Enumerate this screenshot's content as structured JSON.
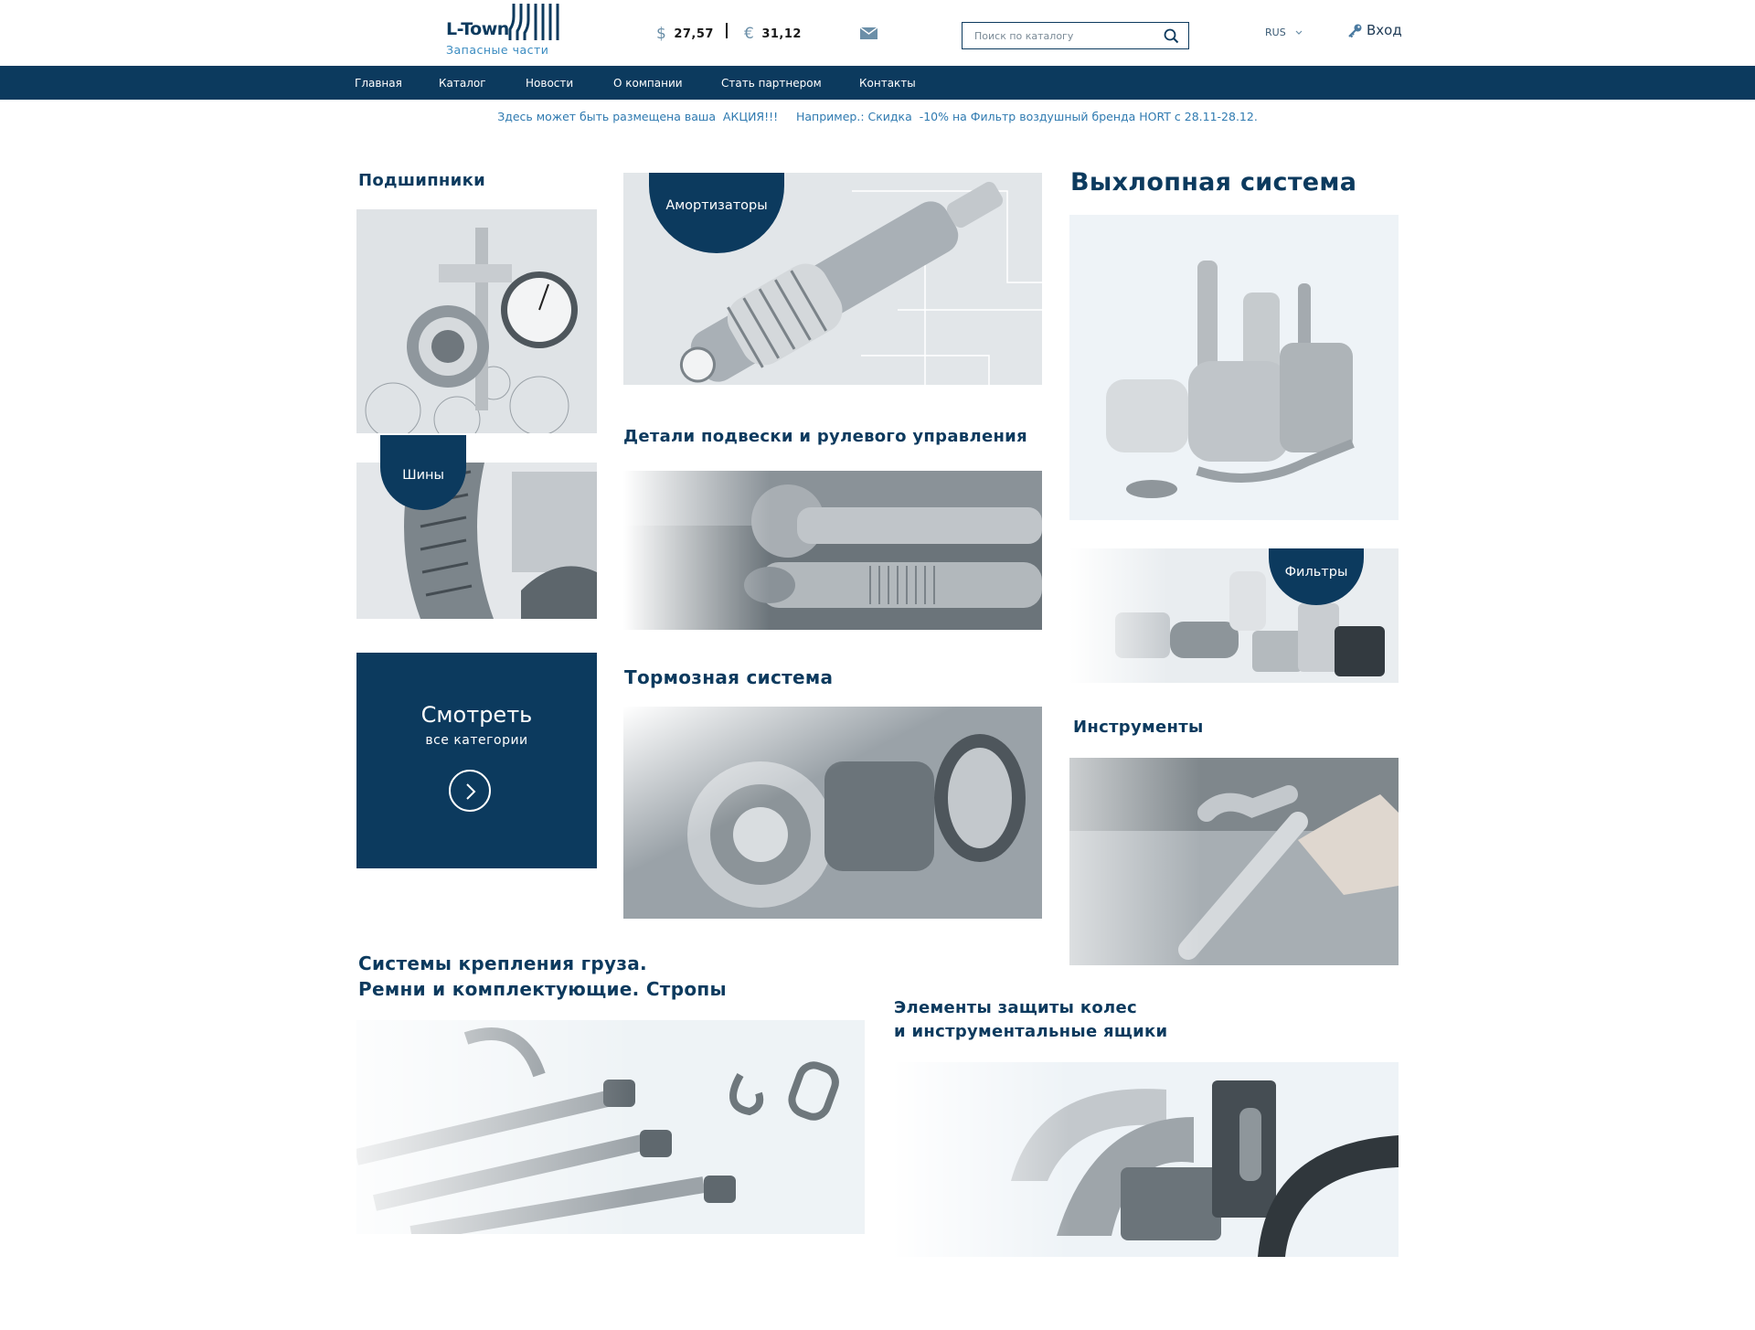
{
  "header": {
    "logo": {
      "name": "L-Town",
      "tagline": "Запасные части"
    },
    "rates": [
      {
        "symbol": "$",
        "value": "27,57"
      },
      {
        "symbol": "€",
        "value": "31,12"
      }
    ],
    "mail_icon": "envelope-icon",
    "search": {
      "placeholder": "Поиск по каталогу",
      "value": "",
      "icon": "search-icon"
    },
    "language": "RUS",
    "login_label": "Вход",
    "login_icon": "key-icon"
  },
  "nav": {
    "items": [
      "Главная",
      "Каталог",
      "Новости",
      "О компании",
      "Стать партнером",
      "Контакты"
    ]
  },
  "promo": "Здесь может быть размещена ваша  АКЦИЯ!!!     Например.: Скидка  -10% на Фильтр воздушный бренда HORT с 28.11-28.12.",
  "categories": {
    "bearings": "Подшипники",
    "shock_absorbers": "Амортизаторы",
    "exhaust": "Выхлопная система",
    "tires": "Шины",
    "suspension": "Детали подвески и рулевого управления",
    "filters": "Фильтры",
    "brakes": "Тормозная система",
    "tools": "Инструменты",
    "cargo_line1": "Системы крепления груза.",
    "cargo_line2": "Ремни и комплектующие. Стропы",
    "wheel_line1": "Элементы защиты колес",
    "wheel_line2": "и инструментальные ящики"
  },
  "all_categories": {
    "title": "Смотреть",
    "subtitle": "все категории",
    "arrow_icon": "chevron-right-icon"
  },
  "colors": {
    "brand": "#0c3a5e",
    "accent": "#3a8bc0",
    "promo_text": "#2f7ab0"
  }
}
